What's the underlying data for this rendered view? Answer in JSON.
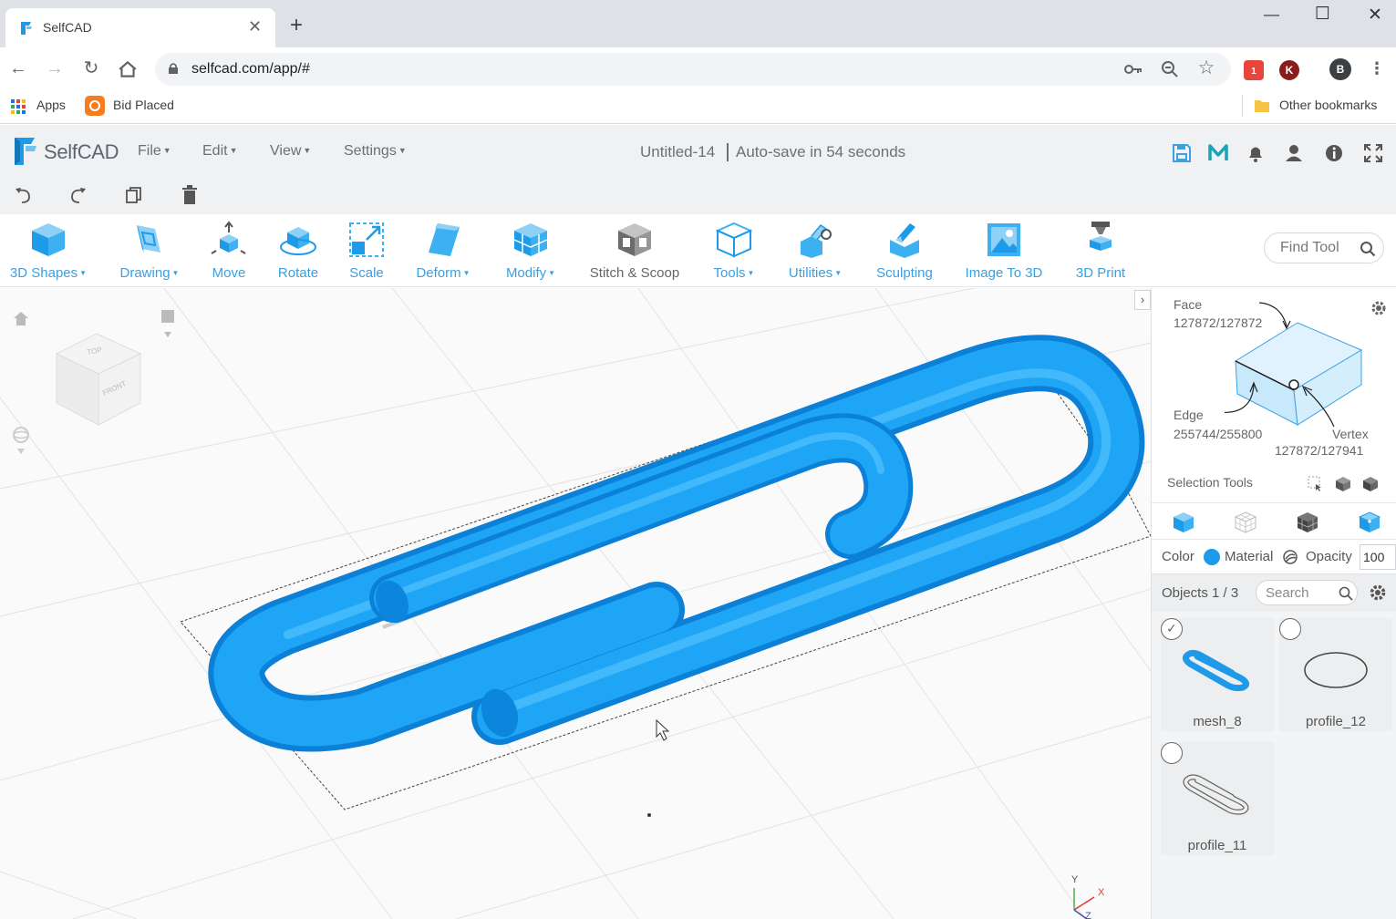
{
  "browser": {
    "tab_title": "SelfCAD",
    "new_tab": "+",
    "url": "selfcad.com/app/#",
    "bookmarks": [
      "Apps",
      "Bid Placed"
    ],
    "other_bookmarks": "Other bookmarks",
    "profile_initial": "B",
    "ext_initial": "K",
    "ext_badge": "1"
  },
  "app": {
    "brand": "SelfCAD",
    "menus": [
      "File",
      "Edit",
      "View",
      "Settings"
    ],
    "document_title": "Untitled-14",
    "autosave": "Auto-save in 54 seconds",
    "find_tool": "Find Tool"
  },
  "tools": [
    {
      "label": "3D Shapes",
      "dropdown": true
    },
    {
      "label": "Drawing",
      "dropdown": true
    },
    {
      "label": "Move",
      "dropdown": false
    },
    {
      "label": "Rotate",
      "dropdown": false
    },
    {
      "label": "Scale",
      "dropdown": false
    },
    {
      "label": "Deform",
      "dropdown": true
    },
    {
      "label": "Modify",
      "dropdown": true
    },
    {
      "label": "Stitch & Scoop",
      "dropdown": false
    },
    {
      "label": "Tools",
      "dropdown": true
    },
    {
      "label": "Utilities",
      "dropdown": true
    },
    {
      "label": "Sculpting",
      "dropdown": false
    },
    {
      "label": "Image To 3D",
      "dropdown": false
    },
    {
      "label": "3D Print",
      "dropdown": false
    }
  ],
  "viewcube": {
    "top": "TOP",
    "front": "FRONT"
  },
  "axes": {
    "x": "X",
    "y": "Y",
    "z": "Z"
  },
  "panel": {
    "face_label": "Face",
    "face_count": "127872/127872",
    "edge_label": "Edge",
    "edge_count": "255744/255800",
    "vertex_label": "Vertex",
    "vertex_count": "127872/127941",
    "selection_tools": "Selection Tools",
    "color_label": "Color",
    "material_label": "Material",
    "opacity_label": "Opacity",
    "opacity_value": "100",
    "objects_label": "Objects 1 / 3",
    "search_placeholder": "Search",
    "accent": "#1e9be8",
    "objects": [
      {
        "name": "mesh_8",
        "checked": true
      },
      {
        "name": "profile_12",
        "checked": false
      },
      {
        "name": "profile_11",
        "checked": false
      }
    ]
  }
}
